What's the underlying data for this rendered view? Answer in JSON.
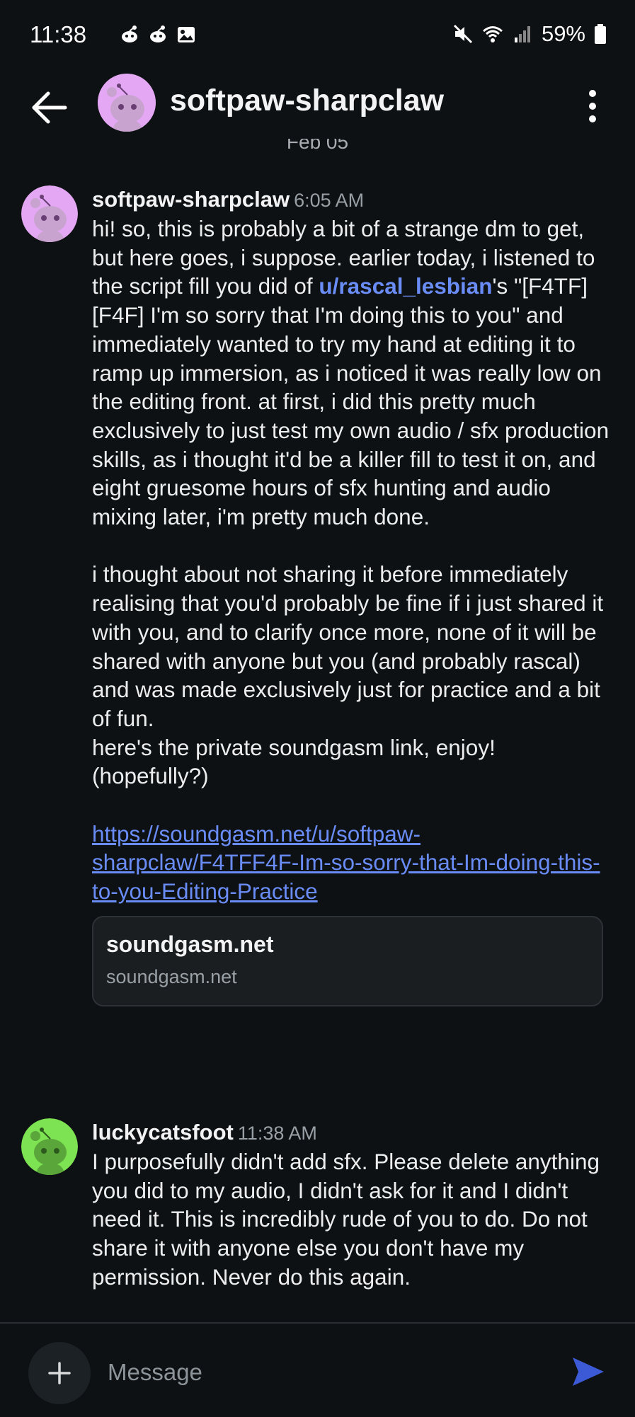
{
  "status_bar": {
    "time": "11:38",
    "battery_text": "59%",
    "icons_left": [
      "reddit-icon",
      "reddit-icon",
      "image-icon"
    ],
    "icons_right": [
      "mute-icon",
      "wifi-icon",
      "signal-icon",
      "battery-icon"
    ]
  },
  "header": {
    "title": "softpaw-sharpclaw",
    "avatar_color": "#e3a7f4"
  },
  "date_separator": "Feb 05",
  "messages": [
    {
      "author": "softpaw-sharpclaw",
      "time": "6:05 AM",
      "avatar_color": "#e3a7f4",
      "text_before_mention": "hi! so, this is probably a bit of a strange dm to get, but here goes, i suppose. earlier today, i listened to the script fill you did of ",
      "mention": "u/rascal_lesbian",
      "text_after_mention": "'s \"[F4TF][F4F] I'm so sorry that I'm doing this to you\" and immediately wanted to try my hand at editing it to ramp up immersion, as i noticed it was really low on the editing front. at first, i did this pretty much exclusively to just test my own audio / sfx production skills, as i thought it'd be a killer fill to test it on, and eight gruesome hours of sfx hunting and audio mixing later, i'm pretty much done.\n\ni thought about not sharing it before immediately realising that you'd probably be fine if i just shared it with you, and to clarify once more, none of it will be shared with anyone but you (and probably rascal) and was made exclusively just for practice and a bit of fun.\nhere's the private soundgasm link, enjoy! (hopefully?)\n\n",
      "link": "https://soundgasm.net/u/softpaw-sharpclaw/F4TFF4F-Im-so-sorry-that-Im-doing-this-to-you-Editing-Practice",
      "link_preview": {
        "title": "soundgasm.net",
        "domain": "soundgasm.net"
      }
    },
    {
      "author": "luckycatsfoot",
      "time": "11:38 AM",
      "avatar_color": "#7ee352",
      "text": "I purposefully didn't add sfx. Please delete anything you did to my audio, I didn't ask for it and I didn't need it. This is incredibly rude of you to do. Do not share it with anyone else you don't have my permission. Never do this again."
    }
  ],
  "composer": {
    "placeholder": "Message"
  },
  "colors": {
    "background": "#0e1113",
    "accent_link": "#6a8cf7",
    "send_button": "#3d5ad6"
  }
}
